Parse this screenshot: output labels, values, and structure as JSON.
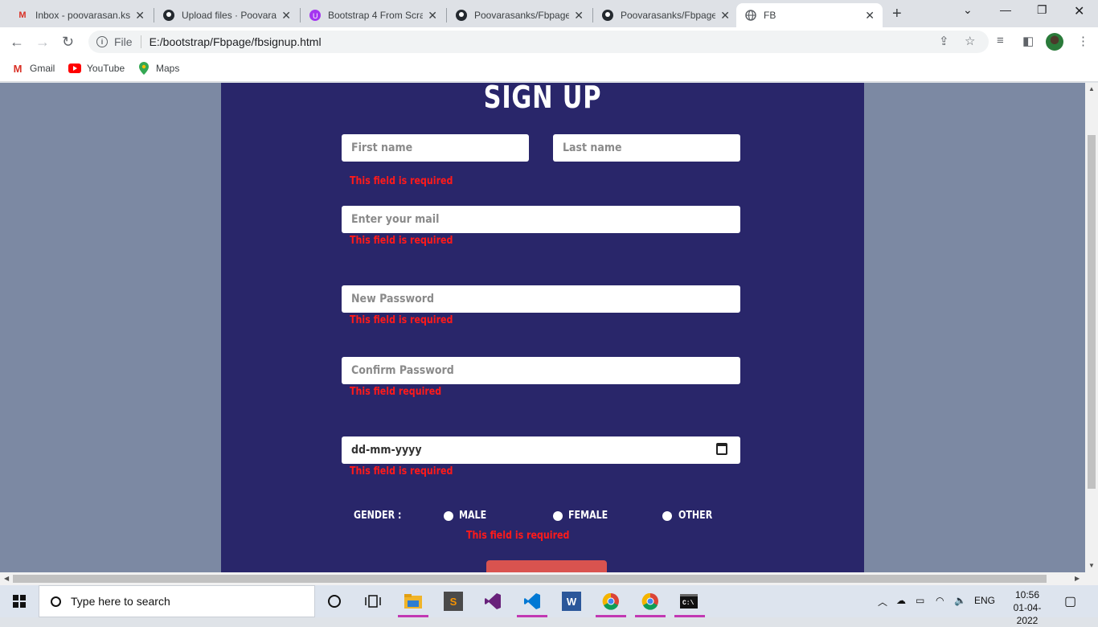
{
  "browser": {
    "tabs": [
      {
        "title": "Inbox - poovarasan.ks",
        "icon": "gmail-icon",
        "active": false
      },
      {
        "title": "Upload files · Poovara",
        "icon": "github-icon",
        "active": false
      },
      {
        "title": "Bootstrap 4 From Scra",
        "icon": "udemy-icon",
        "active": false
      },
      {
        "title": "Poovarasanks/Fbpage",
        "icon": "github-icon",
        "active": false
      },
      {
        "title": "Poovarasanks/Fbpage",
        "icon": "github-icon",
        "active": false
      },
      {
        "title": "FB",
        "icon": "globe-icon",
        "active": true
      }
    ],
    "address": {
      "scheme_label": "File",
      "url": "E:/bootstrap/Fbpage/fbsignup.html"
    },
    "bookmarks": [
      {
        "label": "Gmail",
        "icon": "gmail-icon"
      },
      {
        "label": "YouTube",
        "icon": "youtube-icon"
      },
      {
        "label": "Maps",
        "icon": "maps-icon"
      }
    ]
  },
  "form": {
    "heading": "SIGN UP",
    "first_name_placeholder": "First name",
    "last_name_placeholder": "Last name",
    "name_error": "This field is required",
    "email_placeholder": "Enter your mail",
    "email_error": "This field is required",
    "password_placeholder": "New Password",
    "password_error": "This field is required",
    "confirm_placeholder": "Confirm Password",
    "confirm_error": "This field required",
    "dob_placeholder": "dd-mm-yyyy",
    "dob_error": "This field is required",
    "gender_label": "GENDER :",
    "gender_options": [
      "MALE",
      "FEMALE",
      "OTHER"
    ],
    "gender_error": "This field is required",
    "colors": {
      "card": "#29266a",
      "page_bg": "#7c89a3",
      "error": "#ff1a1a",
      "submit": "#d9534f"
    }
  },
  "taskbar": {
    "search_placeholder": "Type here to search",
    "language": "ENG",
    "time": "10:56",
    "date": "01-04-2022"
  }
}
